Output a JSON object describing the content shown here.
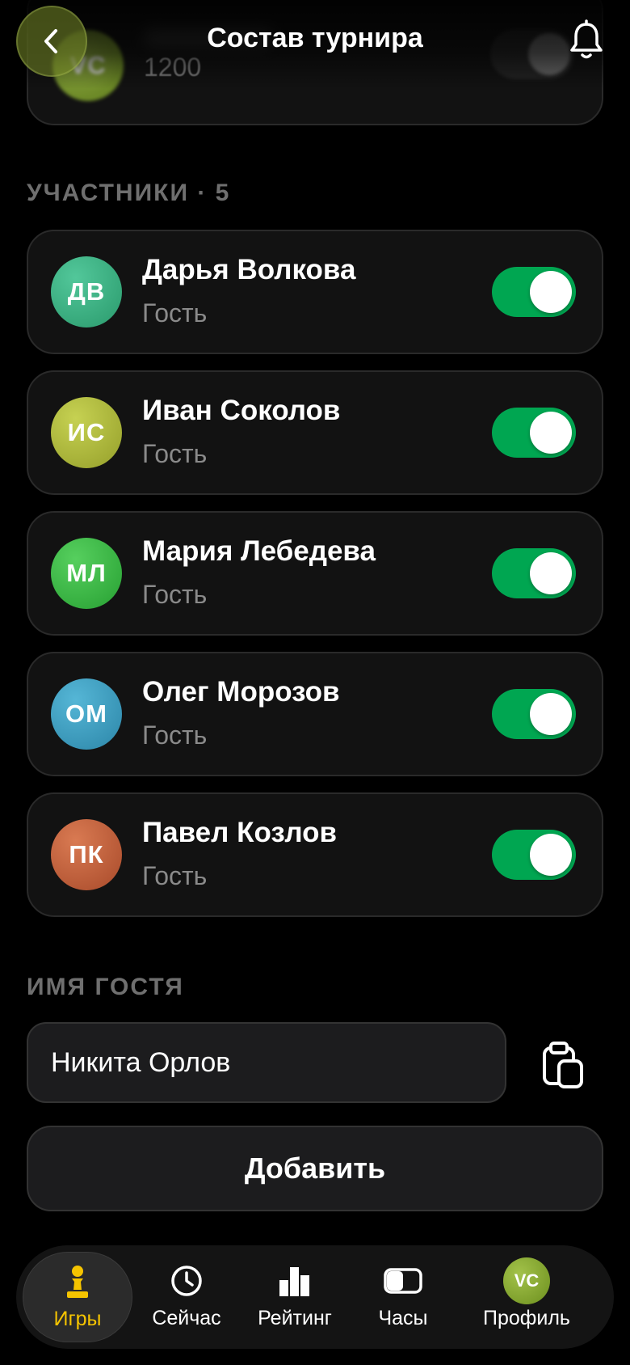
{
  "header": {
    "title": "Состав турнира"
  },
  "top_card": {
    "initials": "VC",
    "rating": "1200",
    "avatar_color": "#8aa63a"
  },
  "participants_section": {
    "label": "УЧАСТНИКИ · 5"
  },
  "participants": [
    {
      "initials": "ДВ",
      "name": "Дарья Волкова",
      "role": "Гость",
      "color_a": "#52c79a",
      "color_b": "#2a9a6c",
      "enabled": true
    },
    {
      "initials": "ИС",
      "name": "Иван Соколов",
      "role": "Гость",
      "color_a": "#c6d152",
      "color_b": "#959f2a",
      "enabled": true
    },
    {
      "initials": "МЛ",
      "name": "Мария Лебедева",
      "role": "Гость",
      "color_a": "#56cf5e",
      "color_b": "#27a032",
      "enabled": true
    },
    {
      "initials": "ОМ",
      "name": "Олег Морозов",
      "role": "Гость",
      "color_a": "#55b6d6",
      "color_b": "#2c86a8",
      "enabled": true
    },
    {
      "initials": "ПК",
      "name": "Павел Козлов",
      "role": "Гость",
      "color_a": "#d97a52",
      "color_b": "#a84a2a",
      "enabled": true
    }
  ],
  "guest_section": {
    "label": "ИМЯ ГОСТЯ",
    "input_value": "Никита Орлов"
  },
  "add_button": {
    "label": "Добавить"
  },
  "tabbar": {
    "tabs": [
      {
        "label": "Игры",
        "icon": "pawn-icon",
        "active": true
      },
      {
        "label": "Сейчас",
        "icon": "clock-icon",
        "active": false
      },
      {
        "label": "Рейтинг",
        "icon": "bar-chart-icon",
        "active": false
      },
      {
        "label": "Часы",
        "icon": "chess-clock-icon",
        "active": false
      },
      {
        "label": "Профиль",
        "icon": "avatar",
        "avatar_initials": "VC",
        "active": false
      }
    ]
  },
  "colors": {
    "toggle_on": "#00a651",
    "active_tab": "#f5c400",
    "card_bg": "#121212"
  }
}
